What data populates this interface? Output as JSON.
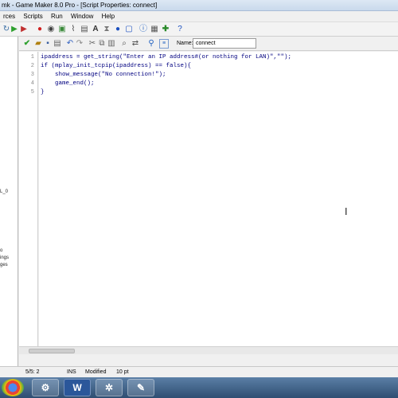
{
  "window": {
    "title": "mk - Game Maker 8.0 Pro - [Script Properties: connect]"
  },
  "menu": {
    "items": [
      "rces",
      "Scripts",
      "Run",
      "Window",
      "Help"
    ]
  },
  "main_toolbar": {
    "icons": [
      "refresh-icon",
      "run-icon",
      "run-debug-icon",
      "add-sprite-icon",
      "add-sound-icon",
      "add-background-icon",
      "add-path-icon",
      "add-script-icon",
      "add-font-icon",
      "add-timeline-icon",
      "add-object-icon",
      "add-room-icon",
      "game-info-icon",
      "game-settings-icon",
      "extensions-icon",
      "help-icon"
    ]
  },
  "left_panel": {
    "fragments": [
      "L_0",
      "o",
      "ings",
      "ges"
    ]
  },
  "script_toolbar": {
    "name_label": "Name:",
    "name_value": "connect"
  },
  "editor": {
    "line_numbers": [
      "1",
      "2",
      "3",
      "4",
      "5"
    ],
    "lines": {
      "l1": "ipaddress = get_string(\"Enter an IP address#(or nothing for LAN)\",\"\");",
      "l2": "if (mplay_init_tcpip(ipaddress) == false){",
      "l3": "    show_message(\"No connection!\");",
      "l4": "    game_end();",
      "l5": "}"
    }
  },
  "status_bar": {
    "position": "5/5: 2",
    "mode": "INS",
    "modified": "Modified",
    "font_size": "10 pt"
  },
  "taskbar": {
    "apps": [
      "chrome-icon",
      "game-maker-icon",
      "word-icon",
      "settings-icon",
      "paint-icon"
    ]
  },
  "colors": {
    "accent": "#3a6ea5",
    "code_text": "#000080",
    "string": "#0000ff"
  }
}
